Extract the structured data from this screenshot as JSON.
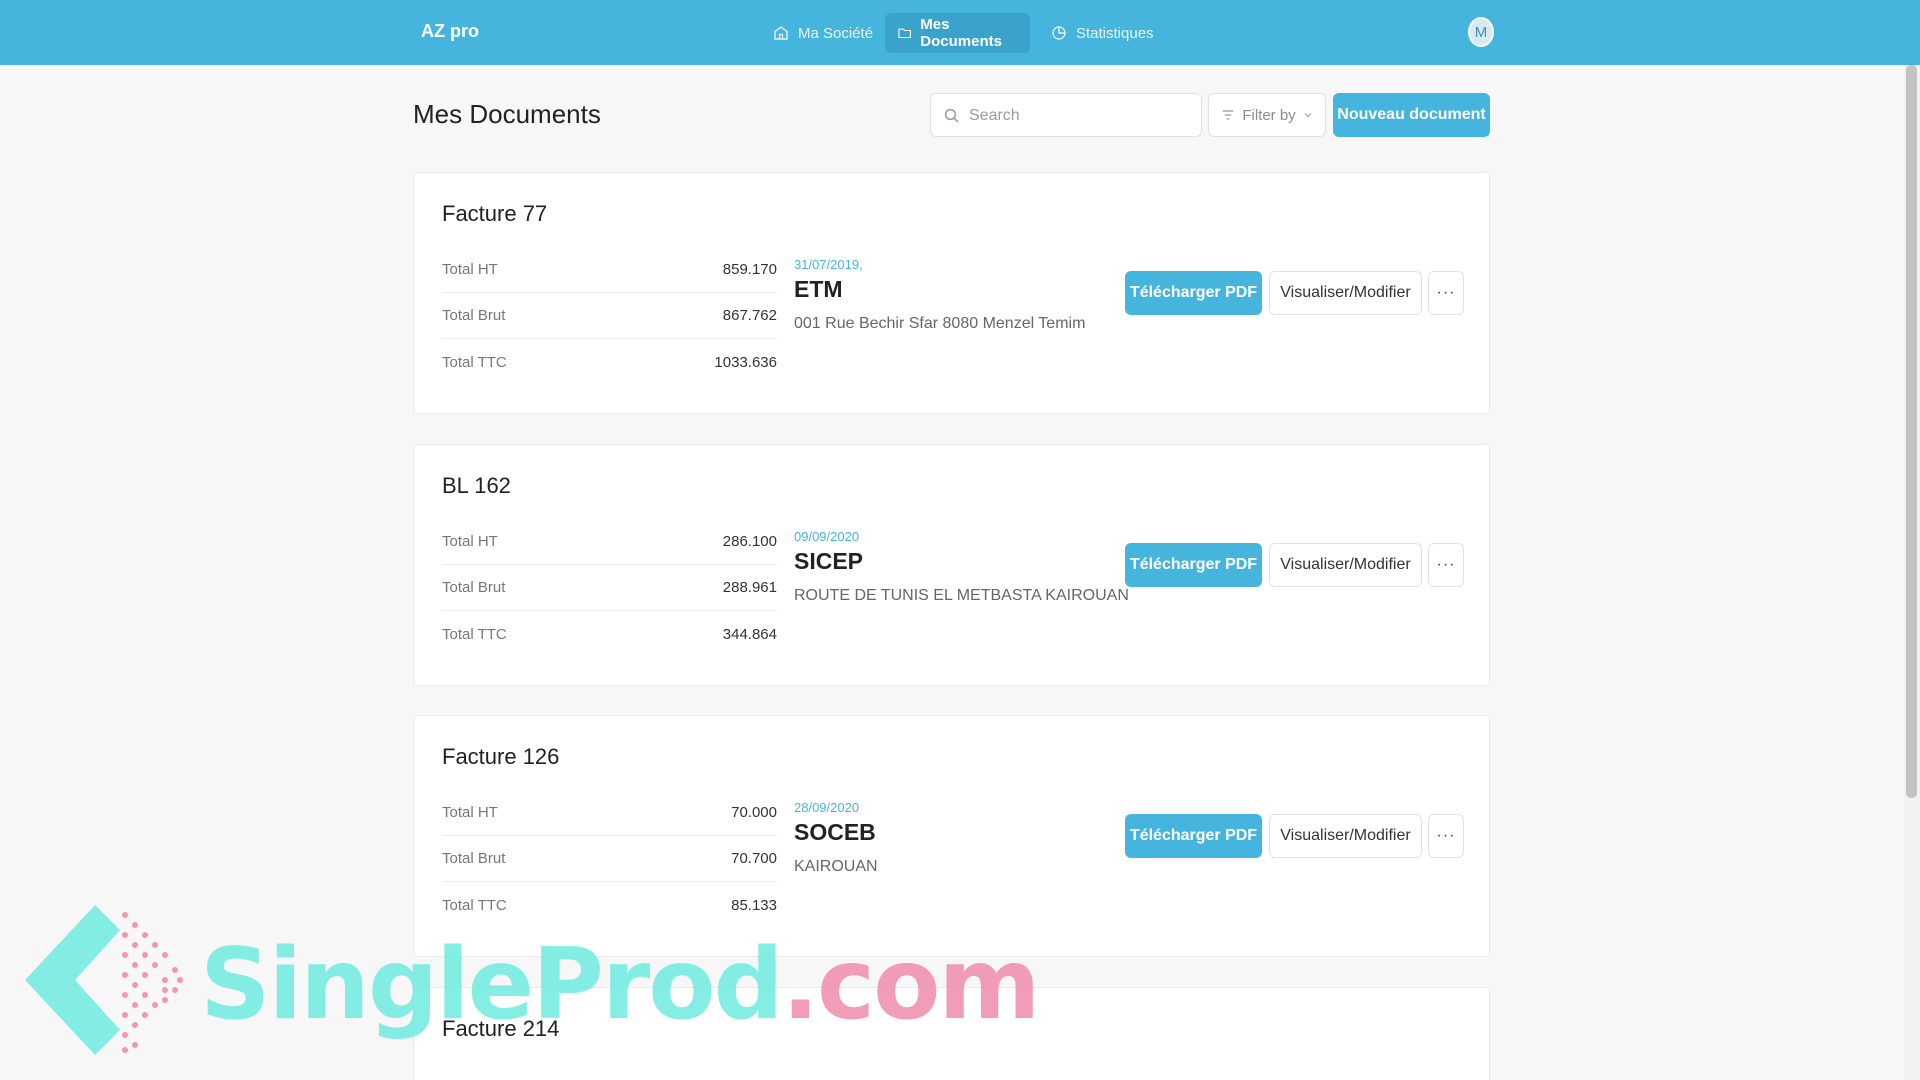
{
  "app": {
    "brand": "AZ pro",
    "user_initial": "M"
  },
  "nav": [
    {
      "label": "Ma Société",
      "icon": "home-icon",
      "active": false
    },
    {
      "label": "Mes Documents",
      "icon": "folder-icon",
      "active": true
    },
    {
      "label": "Statistiques",
      "icon": "pie-chart-icon",
      "active": false
    }
  ],
  "page": {
    "title": "Mes Documents",
    "search_placeholder": "Search",
    "filter_label": "Filter by",
    "new_button": "Nouveau document"
  },
  "actions": {
    "pdf": "Télécharger PDF",
    "view": "Visualiser/Modifier",
    "more": "···"
  },
  "documents": [
    {
      "title": "Facture 77",
      "totals": [
        {
          "label": "Total HT",
          "value": "859.170"
        },
        {
          "label": "Total Brut",
          "value": "867.762"
        },
        {
          "label": "Total TTC",
          "value": "1033.636"
        }
      ],
      "date": "31/07/2019,",
      "client": "ETM",
      "address": "001 Rue Bechir Sfar 8080 Menzel Temim"
    },
    {
      "title": "BL 162",
      "totals": [
        {
          "label": "Total HT",
          "value": "286.100"
        },
        {
          "label": "Total Brut",
          "value": "288.961"
        },
        {
          "label": "Total TTC",
          "value": "344.864"
        }
      ],
      "date": "09/09/2020",
      "client": "SICEP",
      "address": "ROUTE DE TUNIS EL METBASTA KAIROUAN"
    },
    {
      "title": "Facture 126",
      "totals": [
        {
          "label": "Total HT",
          "value": "70.000"
        },
        {
          "label": "Total Brut",
          "value": "70.700"
        },
        {
          "label": "Total TTC",
          "value": "85.133"
        }
      ],
      "date": "28/09/2020",
      "client": "SOCEB",
      "address": "KAIROUAN"
    },
    {
      "title": "Facture 214"
    }
  ],
  "watermark": {
    "part1": "SingleProd",
    "part2": ".com"
  },
  "colors": {
    "accent": "#45b5de",
    "background": "#f7f7f7"
  }
}
